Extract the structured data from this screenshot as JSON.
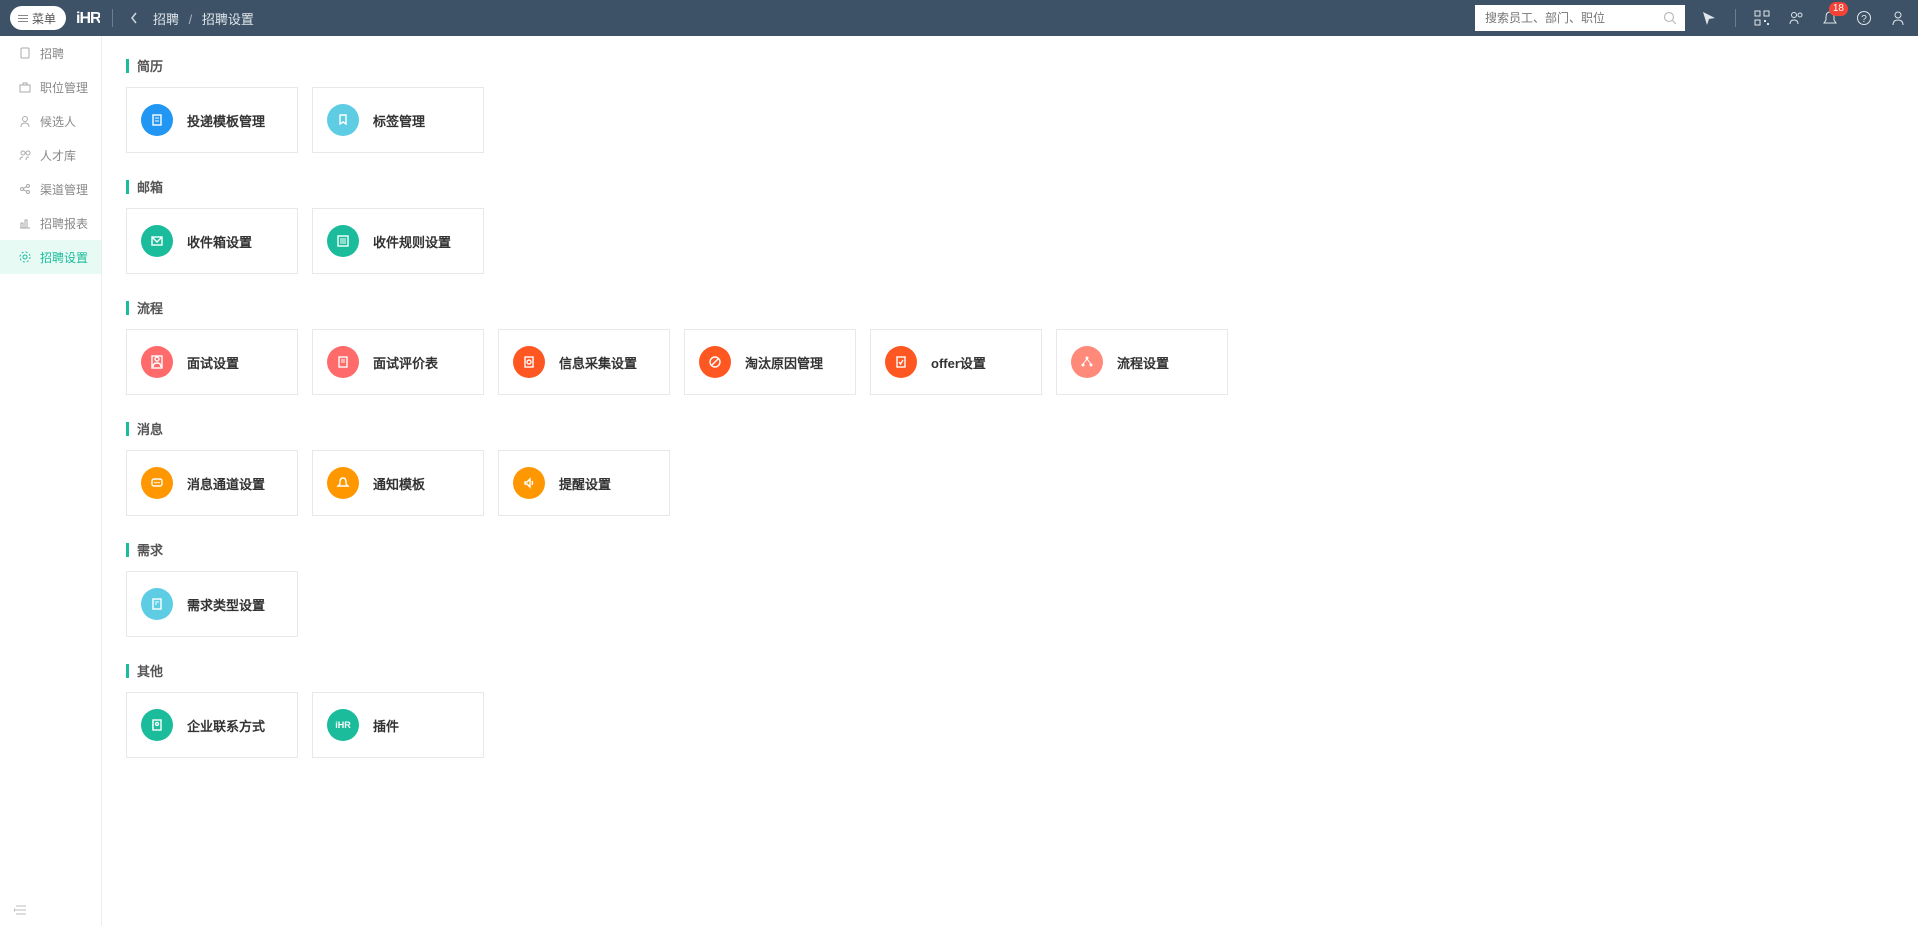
{
  "header": {
    "menu_label": "菜单",
    "logo": "iHR",
    "breadcrumb": {
      "parent": "招聘",
      "current": "招聘设置"
    },
    "search_placeholder": "搜索员工、部门、职位",
    "notif_badge": "18"
  },
  "sidebar": {
    "items": [
      {
        "label": "招聘",
        "icon": "recruit"
      },
      {
        "label": "职位管理",
        "icon": "briefcase"
      },
      {
        "label": "候选人",
        "icon": "user"
      },
      {
        "label": "人才库",
        "icon": "users"
      },
      {
        "label": "渠道管理",
        "icon": "share"
      },
      {
        "label": "招聘报表",
        "icon": "chart"
      },
      {
        "label": "招聘设置",
        "icon": "gear",
        "active": true
      }
    ]
  },
  "sections": [
    {
      "title": "简历",
      "cards": [
        {
          "label": "投递模板管理",
          "color": "c-blue",
          "icon": "file"
        },
        {
          "label": "标签管理",
          "color": "c-sky",
          "icon": "tag"
        }
      ]
    },
    {
      "title": "邮箱",
      "cards": [
        {
          "label": "收件箱设置",
          "color": "c-green",
          "icon": "mail"
        },
        {
          "label": "收件规则设置",
          "color": "c-green",
          "icon": "list"
        }
      ]
    },
    {
      "title": "流程",
      "cards": [
        {
          "label": "面试设置",
          "color": "c-red",
          "icon": "interview"
        },
        {
          "label": "面试评价表",
          "color": "c-red",
          "icon": "form"
        },
        {
          "label": "信息采集设置",
          "color": "c-vermilion",
          "icon": "collect"
        },
        {
          "label": "淘汰原因管理",
          "color": "c-vermilion",
          "icon": "reject"
        },
        {
          "label": "offer设置",
          "color": "c-vermilion",
          "icon": "offer"
        },
        {
          "label": "流程设置",
          "color": "c-coral",
          "icon": "flow"
        }
      ]
    },
    {
      "title": "消息",
      "cards": [
        {
          "label": "消息通道设置",
          "color": "c-orange",
          "icon": "chat"
        },
        {
          "label": "通知模板",
          "color": "c-orange",
          "icon": "bell"
        },
        {
          "label": "提醒设置",
          "color": "c-orange",
          "icon": "sound"
        }
      ]
    },
    {
      "title": "需求",
      "cards": [
        {
          "label": "需求类型设置",
          "color": "c-sky",
          "icon": "demand"
        }
      ]
    },
    {
      "title": "其他",
      "cards": [
        {
          "label": "企业联系方式",
          "color": "c-green",
          "icon": "contact"
        },
        {
          "label": "插件",
          "color": "c-green",
          "icon": "plugin"
        }
      ]
    }
  ]
}
